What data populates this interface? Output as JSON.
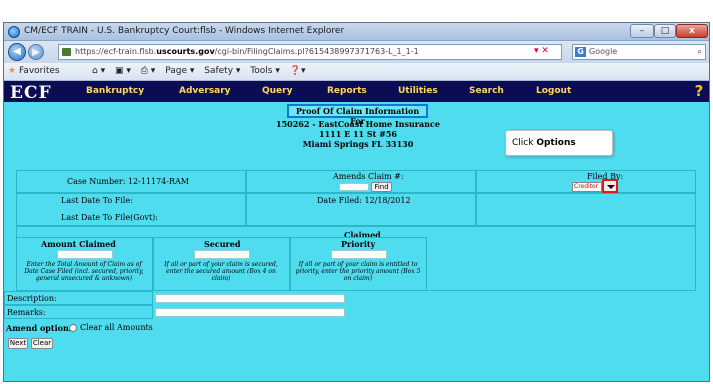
{
  "window": {
    "title": "CM/ECF TRAIN - U.S. Bankruptcy Court:flsb - Windows Internet Explorer",
    "min_label": "–",
    "max_label": "□",
    "close_label": "x"
  },
  "addressbar": {
    "url_prefix": "https://ecf-train.flsb.",
    "url_domain": "uscourts.gov",
    "url_suffix": "/cgi-bin/FilingClaims.pl?615438997371763-L_1_1-1",
    "search_placeholder": "Google"
  },
  "commandbar": {
    "favorites": "Favorites",
    "tools": [
      "Page ▾",
      "Safety ▾",
      "Tools ▾"
    ]
  },
  "ecf": {
    "logo": "ECF",
    "menu": [
      "Bankruptcy",
      "Adversary",
      "Query",
      "Reports",
      "Utilities",
      "Search",
      "Logout"
    ]
  },
  "claim": {
    "header": "Proof Of Claim Information For",
    "debtor_line1": "150262 - EastCoast Home Insurance",
    "debtor_line2": "1111 E 11 St #56",
    "debtor_line3": "Miami Springs FL 33130",
    "case_number_label": "Case Number: 12-11174-RAM",
    "amends_label": "Amends Claim #:",
    "find_button": "Find",
    "filed_by_label": "Filed By:",
    "filed_by_value": "Creditor",
    "last_date_file": "Last Date To File:",
    "date_filed": "Date Filed: 12/18/2012",
    "last_date_govt": "Last Date To File(Govt):",
    "claimed_header": "Claimed",
    "amount_claimed_label": "Amount Claimed",
    "amount_claimed_help": "Enter the Total Amount of Claim as of Date Case Filed (incl. secured, priority, general unsecured & unknown)",
    "secured_label": "Secured",
    "secured_help": "If all or part of your claim is secured, enter the secured amount (Box 4 on claim)",
    "priority_label": "Priority",
    "priority_help": "If all or part of your claim is entitled to priority, enter the priority amount (Box 5 on claim)",
    "description_label": "Description:",
    "remarks_label": "Remarks:",
    "amend_options_label": "Amend options:",
    "clear_all_label": "Clear all Amounts",
    "next_button": "Next",
    "clear_button": "Clear"
  },
  "tooltip": {
    "prefix": "Click ",
    "emphasis": "Options"
  },
  "colors": {
    "content_bg": "#4fdcee",
    "header_bg": "#0c0c55",
    "menu_text": "#ffd95a",
    "highlight_box": "#1278d8",
    "dropdown_outline": "#e01818"
  }
}
